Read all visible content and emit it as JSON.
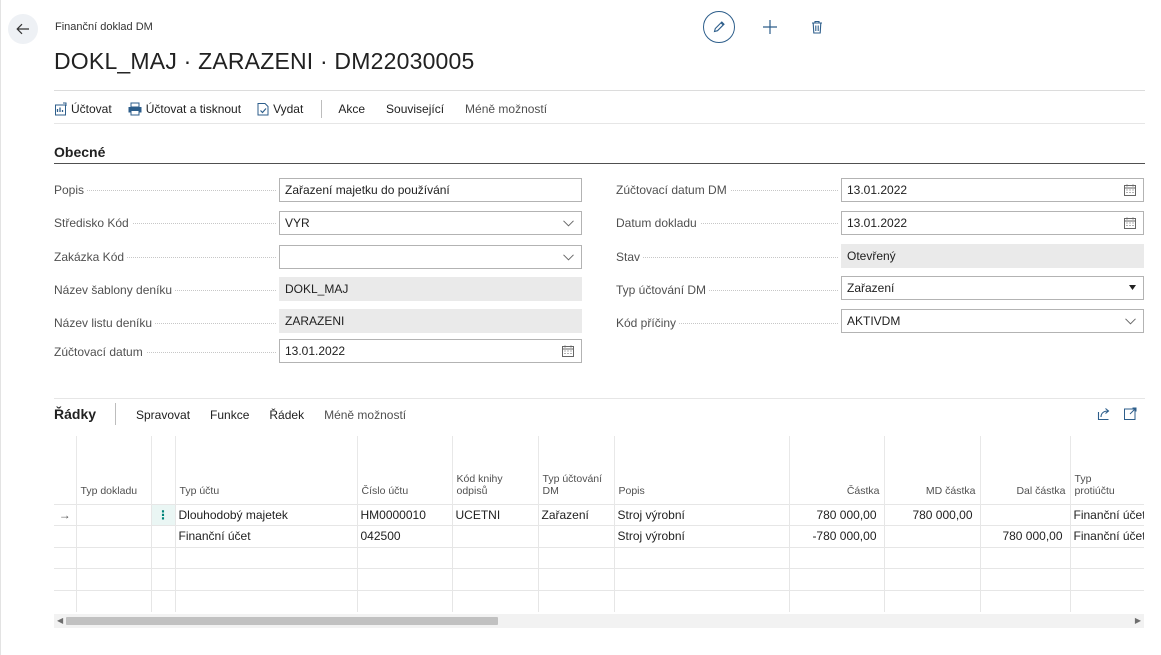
{
  "page": {
    "caption": "Finanční doklad DM",
    "title": "DOKL_MAJ · ZARAZENI · DM22030005"
  },
  "toolbar": {
    "post": "Účtovat",
    "post_print": "Účtovat a tisknout",
    "release": "Vydat",
    "actions": "Akce",
    "related": "Související",
    "fewer": "Méně možností"
  },
  "general": {
    "section_title": "Obecné",
    "left": [
      {
        "label": "Popis",
        "value": "Zařazení majetku do používání"
      },
      {
        "label": "Středisko Kód",
        "value": "VYR"
      },
      {
        "label": "Zakázka Kód",
        "value": ""
      },
      {
        "label": "Název šablony deníku",
        "value": "DOKL_MAJ"
      },
      {
        "label": "Název listu deníku",
        "value": "ZARAZENI"
      },
      {
        "label": "Zúčtovací datum",
        "value": "13.01.2022"
      }
    ],
    "right": [
      {
        "label": "Zúčtovací datum DM",
        "value": "13.01.2022"
      },
      {
        "label": "Datum dokladu",
        "value": "13.01.2022"
      },
      {
        "label": "Stav",
        "value": "Otevřený"
      },
      {
        "label": "Typ účtování DM",
        "value": "Zařazení"
      },
      {
        "label": "Kód příčiny",
        "value": "AKTIVDM"
      }
    ]
  },
  "lines": {
    "title": "Řádky",
    "menu": [
      "Spravovat",
      "Funkce",
      "Řádek",
      "Méně možností"
    ],
    "columns": {
      "doc_type": "Typ dokladu",
      "account_type": "Typ účtu",
      "account_no": "Číslo účtu",
      "depr_book_1": "Kód knihy",
      "depr_book_2": "odpisů",
      "fa_posting_1": "Typ účtování",
      "fa_posting_2": "DM",
      "description": "Popis",
      "amount": "Částka",
      "debit": "MD částka",
      "credit": "Dal částka",
      "bal_type_1": "Typ",
      "bal_type_2": "protiúčtu"
    },
    "rows": [
      {
        "account_type": "Dlouhodobý majetek",
        "account_no": "HM0000010",
        "depr_book": "UCETNI",
        "fa_posting": "Zařazení",
        "description": "Stroj výrobní",
        "amount": "780 000,00",
        "debit": "780 000,00",
        "credit": "",
        "bal_type": "Finanční účet"
      },
      {
        "account_type": "Finanční účet",
        "account_no": "042500",
        "depr_book": "",
        "fa_posting": "",
        "description": "Stroj výrobní",
        "amount": "-780 000,00",
        "debit": "",
        "credit": "780 000,00",
        "bal_type": "Finanční účet"
      }
    ],
    "row_marker": "→",
    "row_menu": "⋮"
  },
  "icons": {
    "back": "arrow-left-icon",
    "edit": "pencil-icon",
    "new": "plus-icon",
    "delete": "trash-icon",
    "calendar": "calendar-icon",
    "chevron": "chevron-down-icon",
    "share": "share-icon",
    "expand": "expand-icon"
  },
  "colors": {
    "accent": "#2d5e8b",
    "readonly_bg": "#eaeaea",
    "row_menu": "#00857a"
  }
}
